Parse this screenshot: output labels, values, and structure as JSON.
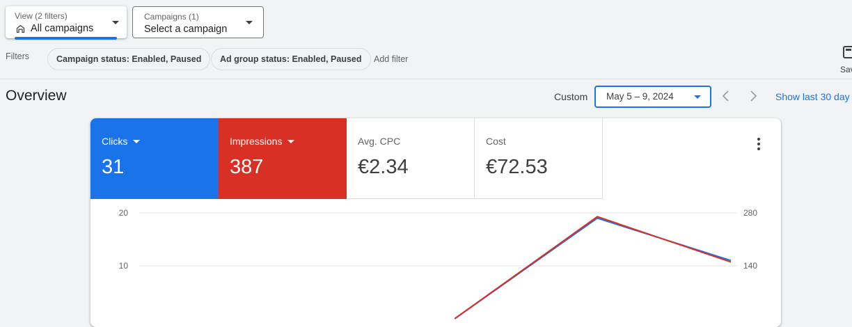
{
  "view_selector": {
    "label": "View (2 filters)",
    "value": "All campaigns"
  },
  "campaign_selector": {
    "label": "Campaigns (1)",
    "value": "Select a campaign"
  },
  "filters": {
    "label": "Filters",
    "chips": [
      "Campaign status: Enabled, Paused",
      "Ad group status: Enabled, Paused"
    ],
    "add_filter": "Add filter"
  },
  "toolbar": {
    "save_label": "Sav"
  },
  "overview": {
    "title": "Overview",
    "range_label": "Custom",
    "date_range": "May 5 – 9, 2024",
    "show_last": "Show last 30 day"
  },
  "metrics": [
    {
      "label": "Clicks",
      "value": "31",
      "color": "#1a73e8"
    },
    {
      "label": "Impressions",
      "value": "387",
      "color": "#d93025"
    },
    {
      "label": "Avg. CPC",
      "value": "€2.34"
    },
    {
      "label": "Cost",
      "value": "€72.53"
    }
  ],
  "chart_data": {
    "type": "line",
    "y_left_ticks": [
      "20",
      "10"
    ],
    "y_right_ticks": [
      "280",
      "140"
    ],
    "ylim_left": [
      0,
      20
    ],
    "ylim_right": [
      0,
      280
    ],
    "x_fraction": [
      0.5333,
      0.7742,
      1.0
    ],
    "series": [
      {
        "name": "Clicks",
        "axis": "left",
        "color": "#1a73e8",
        "values": [
          0,
          19,
          11
        ]
      },
      {
        "name": "Impressions",
        "axis": "right",
        "color": "#d93025",
        "values": [
          0,
          270,
          150
        ]
      }
    ]
  }
}
